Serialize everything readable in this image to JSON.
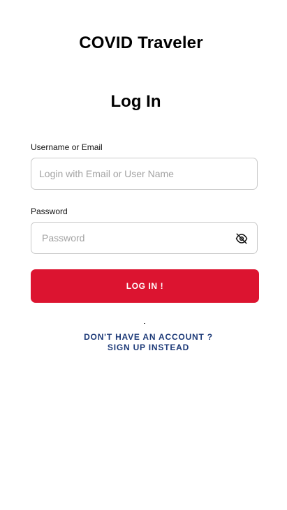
{
  "app": {
    "title": "COVID Traveler"
  },
  "page": {
    "heading": "Log In"
  },
  "form": {
    "username": {
      "label": "Username or Email",
      "placeholder": "Login with Email or User Name",
      "value": ""
    },
    "password": {
      "label": "Password",
      "placeholder": "Password",
      "value": "",
      "toggle_icon": "eye-off-icon"
    },
    "submit_label": "LOG IN !"
  },
  "signup": {
    "line1": "DON'T HAVE AN ACCOUNT ?",
    "line2": "SIGN UP INSTEAD"
  },
  "colors": {
    "primary_button": "#dc1430",
    "link": "#1d3a78",
    "input_border": "#c9c9c9",
    "placeholder": "#a3a3a3"
  }
}
